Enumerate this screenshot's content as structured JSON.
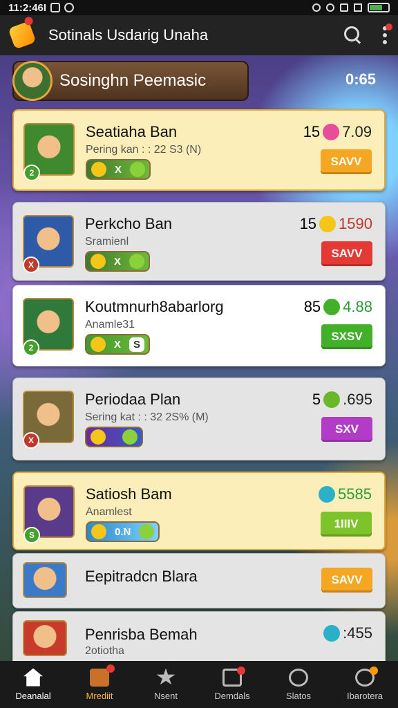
{
  "status_bar": {
    "time": "11:2:46I"
  },
  "app_bar": {
    "title": "Sotinals Usdarig Unaha"
  },
  "banner": {
    "title": "Sosinghn Peemasic",
    "timer": "0:65"
  },
  "cards": [
    {
      "name": "Seatiaha Ban",
      "sub": "Pering kan : : 22 S3 (N)",
      "pill": "X",
      "price_qty": "15",
      "price_value": "7.09",
      "cta": "SAVV",
      "cta_color": "#f5a623",
      "avatar_color": "#3f8a2e",
      "currency_color": "#e84d9b",
      "lvl": "2"
    },
    {
      "name": "Perkcho Ban",
      "sub": "Sramienl",
      "pill": "X",
      "price_qty": "15",
      "price_value": "1590",
      "cta": "SAVV",
      "cta_color": "#e53935",
      "avatar_color": "#2e5aa8",
      "currency_color": "#f5c518",
      "lvl": "X"
    },
    {
      "name": "Koutmnurh8abarlorg",
      "sub": "Anamle31",
      "pill": "X",
      "pill_extra": "S",
      "price_qty": "85",
      "price_value": "4.88",
      "cta": "SXSV",
      "cta_color": "#43b02a",
      "avatar_color": "#2f7a3a",
      "currency_color": "#43b02a",
      "lvl": "2"
    },
    {
      "name": "Periodaa Plan",
      "sub": "Sering kat  : : 32 2S% (M)",
      "pill": "",
      "price_qty": "5",
      "price_value": ".695",
      "cta": "SXV",
      "cta_color": "#b23cc8",
      "avatar_color": "#7a6a3a",
      "currency_color": "#6ab82a",
      "lvl": "X"
    },
    {
      "name": "Satiosh Bam",
      "sub": "Anamlest",
      "pill": "0.N",
      "price_qty": "",
      "price_value": "5585",
      "cta": "1IIIV",
      "cta_color": "#7cc42a",
      "avatar_color": "#5a3a8a",
      "currency_color": "#2ab0c8",
      "lvl": "S"
    },
    {
      "name": "Eepitradcn Blara",
      "sub": "",
      "pill": "",
      "price_qty": "",
      "price_value": "",
      "cta": "SAVV",
      "cta_color": "#f5a623",
      "avatar_color": "#3a7ac8",
      "currency_color": "",
      "lvl": ""
    },
    {
      "name": "Penrisba Bemah",
      "sub": "2otiotha",
      "pill": "",
      "price_qty": "",
      "price_value": ":455",
      "cta": "",
      "cta_color": "#f5a623",
      "avatar_color": "#c83a2a",
      "currency_color": "#2ab0c8",
      "lvl": ""
    }
  ],
  "nav": [
    {
      "label": "Deanalal"
    },
    {
      "label": "Mrediit"
    },
    {
      "label": "Nsent"
    },
    {
      "label": "Demdals"
    },
    {
      "label": "Slatos"
    },
    {
      "label": "Ibarotera"
    }
  ]
}
